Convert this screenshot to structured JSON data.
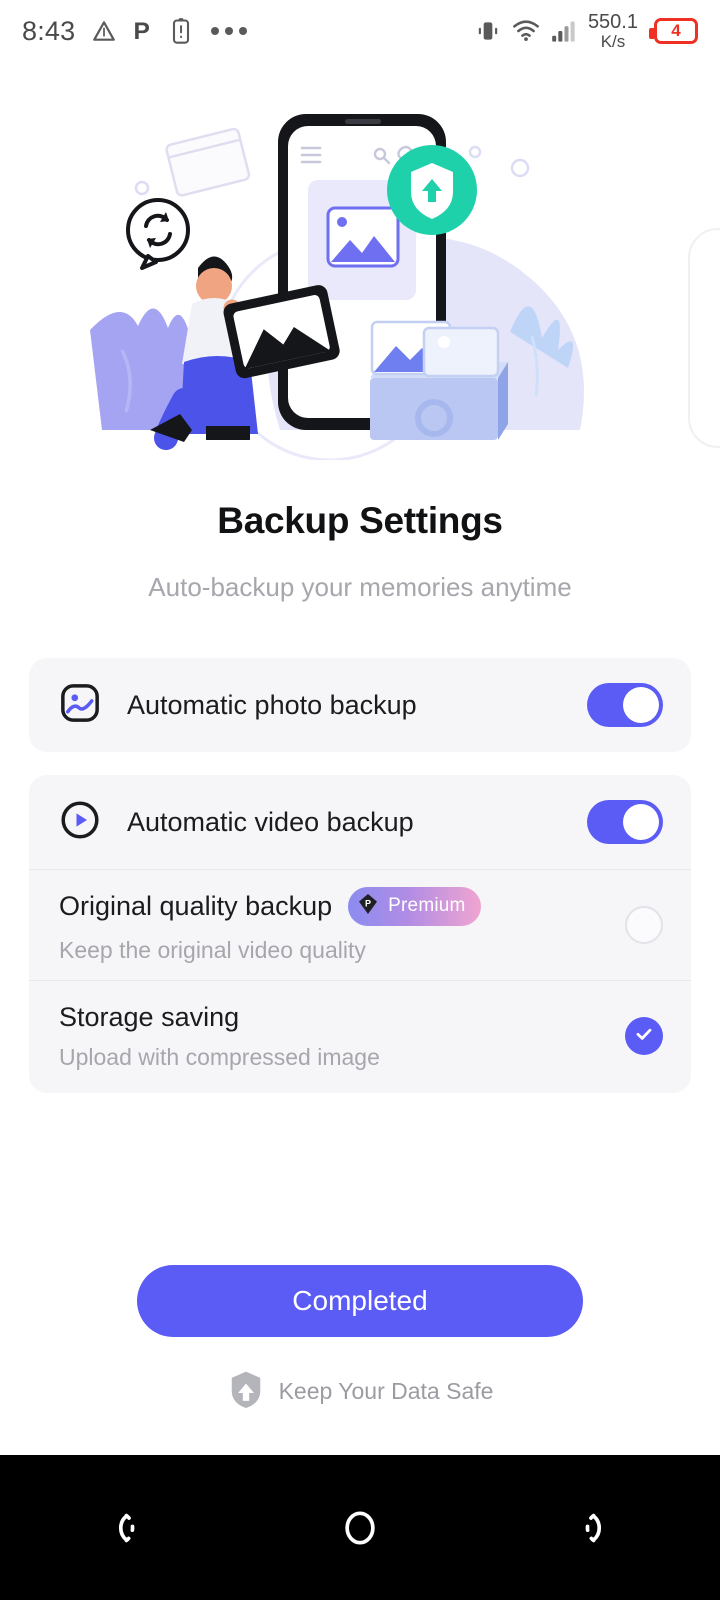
{
  "status_bar": {
    "time": "8:43",
    "icons_left": [
      "triangle-alert-icon",
      "parking-p-icon",
      "battery-alert-icon",
      "more-dots-icon"
    ],
    "net_speed_value": "550.1",
    "net_speed_unit": "K/s",
    "battery_level": "4",
    "battery_color": "#ef3124",
    "icons_right": [
      "vibrate-icon",
      "wifi-icon",
      "signal-icon"
    ]
  },
  "hero": {
    "icon": "backup-illustration",
    "shield_badge_color": "#1fd1ab",
    "accent_blue": "#5b5bf5"
  },
  "page": {
    "title": "Backup Settings",
    "subtitle": "Auto-backup your memories anytime"
  },
  "settings": {
    "photo_backup": {
      "icon": "photo-image-icon",
      "label": "Automatic photo backup",
      "toggle_on": true
    },
    "video_backup": {
      "icon": "video-play-icon",
      "label": "Automatic video backup",
      "toggle_on": true
    },
    "options": [
      {
        "title": "Original quality backup",
        "subtitle": "Keep the original video quality",
        "badge": "Premium",
        "badge_icon": "premium-gem-icon",
        "selected": false
      },
      {
        "title": "Storage saving",
        "subtitle": "Upload with compressed image",
        "badge": null,
        "selected": true
      }
    ]
  },
  "cta": {
    "label": "Completed",
    "color": "#5b5bf5"
  },
  "footer": {
    "icon": "shield-upload-icon",
    "text": "Keep Your Data Safe"
  },
  "navbar": {
    "back": "back-nav-icon",
    "home": "home-nav-icon",
    "recents": "recents-nav-icon"
  }
}
